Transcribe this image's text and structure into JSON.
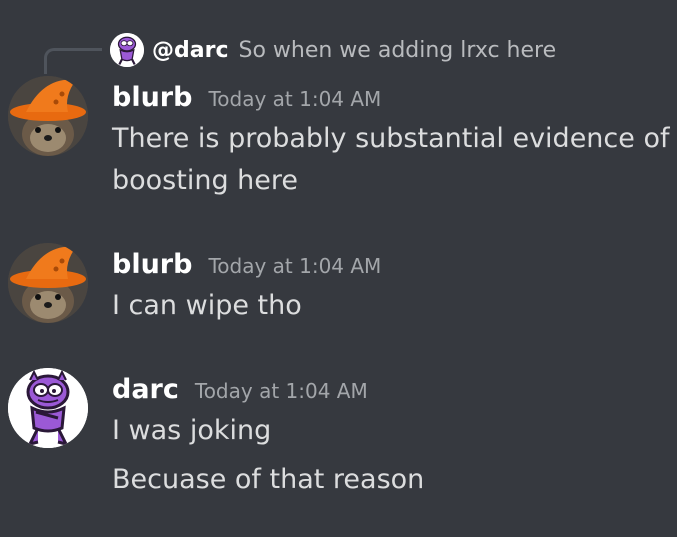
{
  "colors": {
    "background": "#36393f",
    "username": "#ffffff",
    "message_text": "#dcddde",
    "timestamp": "#a3a6aa",
    "reply_text": "#b9bbbe",
    "reply_spine": "#4f545c",
    "avatar_hat_orange": "#f07a1c",
    "avatar_garfield_purple": "#9b59d6"
  },
  "reply": {
    "author": "@darc",
    "text": "So when we adding lrxc here",
    "avatar_icon": "garfield-avatar-icon"
  },
  "messages": [
    {
      "author": "blurb",
      "timestamp": "Today at 1:04 AM",
      "avatar_icon": "otter-witch-hat-avatar-icon",
      "lines": [
        "There is probably substantial evidence of",
        "boosting here"
      ]
    },
    {
      "author": "blurb",
      "timestamp": "Today at 1:04 AM",
      "avatar_icon": "otter-witch-hat-avatar-icon",
      "lines": [
        "I can wipe tho"
      ]
    },
    {
      "author": "darc",
      "timestamp": "Today at 1:04 AM",
      "avatar_icon": "garfield-avatar-icon",
      "lines": [
        "I was joking",
        "Becuase of that reason"
      ]
    }
  ]
}
